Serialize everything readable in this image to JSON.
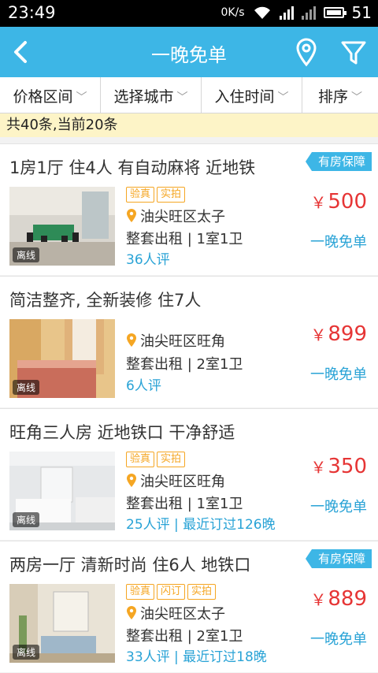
{
  "status": {
    "time": "23:49",
    "net_speed": "0K/s",
    "battery": "51",
    "network": "3G"
  },
  "header": {
    "title": "一晚免单"
  },
  "filters": [
    {
      "label": "价格区间"
    },
    {
      "label": "选择城市"
    },
    {
      "label": "入住时间"
    },
    {
      "label": "排序"
    }
  ],
  "count_text": "共40条,当前20条",
  "listings": [
    {
      "title": "1房1厅 住4人 有自动麻将 近地铁",
      "badge": "有房保障",
      "tags": [
        "验真",
        "实拍"
      ],
      "address": "油尖旺区太子",
      "rent": "整套出租 | 1室1卫",
      "reviews": "36人评",
      "price": "500",
      "promo": "一晚免单",
      "offline": "离线"
    },
    {
      "title": "简洁整齐, 全新装修 住7人",
      "badge": "",
      "tags": [],
      "address": "油尖旺区旺角",
      "rent": "整套出租 | 2室1卫",
      "reviews": "6人评",
      "price": "899",
      "promo": "一晚免单",
      "offline": "离线"
    },
    {
      "title": "旺角三人房 近地铁口 干净舒适",
      "badge": "",
      "tags": [
        "验真",
        "实拍"
      ],
      "address": "油尖旺区旺角",
      "rent": "整套出租 | 1室1卫",
      "reviews": "25人评 | 最近订过126晚",
      "price": "350",
      "promo": "一晚免单",
      "offline": "离线"
    },
    {
      "title": "两房一厅 清新时尚 住6人 地铁口",
      "badge": "有房保障",
      "tags": [
        "验真",
        "闪订",
        "实拍"
      ],
      "address": "油尖旺区太子",
      "rent": "整套出租 | 2室1卫",
      "reviews": "33人评 | 最近订过18晚",
      "price": "889",
      "promo": "一晚免单",
      "offline": "离线"
    }
  ],
  "currency": "￥"
}
